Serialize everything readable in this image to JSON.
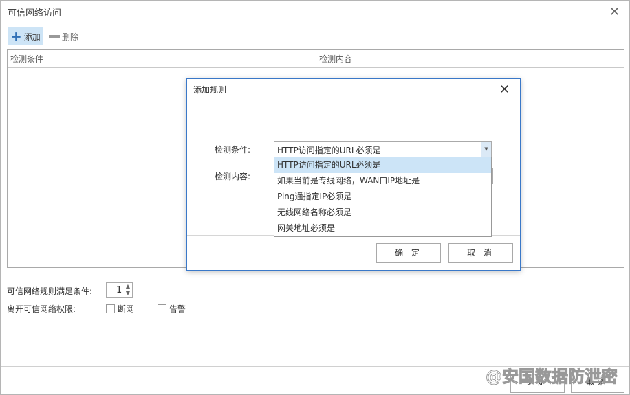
{
  "window": {
    "title": "可信网络访问",
    "close": "✕"
  },
  "toolbar": {
    "add_label": "添加",
    "delete_label": "删除"
  },
  "table": {
    "columns": [
      "检测条件",
      "检测内容"
    ],
    "rows": []
  },
  "settings": {
    "min_rules_label": "可信网络规则满足条件:",
    "min_rules_value": "1",
    "leave_label": "离开可信网络权限:",
    "options": [
      {
        "label": "断网",
        "checked": false
      },
      {
        "label": "告警",
        "checked": false
      }
    ]
  },
  "footer": {
    "ok_label": "确定",
    "cancel_label": "取消"
  },
  "dialog": {
    "title": "添加规则",
    "close": "✕",
    "condition_label": "检测条件:",
    "condition_value": "HTTP访问指定的URL必须是",
    "content_label": "检测内容:",
    "options": [
      "HTTP访问指定的URL必须是",
      "如果当前是专线网络，WAN口IP地址是",
      "Ping通指定IP必须是",
      "无线网络名称必须是",
      "网关地址必须是"
    ],
    "selected_index": 0,
    "ok_label": "确 定",
    "cancel_label": "取 消"
  },
  "watermark": "@安国数据防泄密",
  "colors": {
    "accent": "#3a78c8",
    "selection": "#cce4f7",
    "add_icon": "#2f6fb5"
  }
}
